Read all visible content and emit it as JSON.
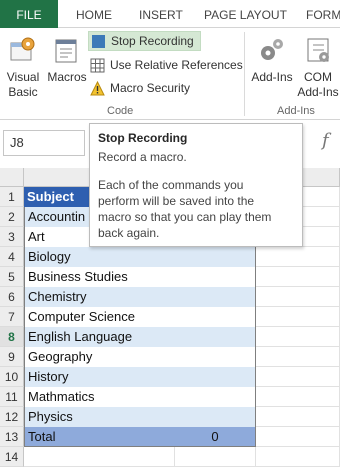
{
  "ribbon": {
    "tabs": [
      "FILE",
      "HOME",
      "INSERT",
      "PAGE LAYOUT",
      "FORM"
    ],
    "file_color": "#217346",
    "code_group": {
      "visual_basic": "Visual\nBasic",
      "macros": "Macros",
      "stop_recording": "Stop Recording",
      "relative_references": "Use Relative References",
      "macro_security": "Macro Security",
      "label": "Code"
    },
    "addins_group": {
      "addins": "Add-Ins",
      "com_addins": "COM\nAdd-Ins",
      "label": "Add-Ins"
    }
  },
  "formula_bar": {
    "name_box": "J8",
    "fx_icon": "fx-icon"
  },
  "tooltip": {
    "title": "Stop Recording",
    "subtitle": "Record a macro.",
    "body": "Each of the commands you\nperform will be saved into the\nmacro so that you can play them\nback again."
  },
  "sheet": {
    "row_numbers": [
      "1",
      "2",
      "3",
      "4",
      "5",
      "6",
      "7",
      "8",
      "9",
      "10",
      "11",
      "12",
      "13",
      "14"
    ],
    "selected_row": "8",
    "header": "Subject",
    "subjects": [
      "Accountin",
      "Art",
      "Biology",
      "Business Studies",
      "Chemistry",
      "Computer Science",
      "English Language",
      "Geography",
      "History",
      "Mathmatics",
      "Physics"
    ],
    "total_label": "Total",
    "total_value": "0",
    "colors": {
      "header_fill": "#2e5fb0",
      "band_fill": "#dce9f6",
      "total_fill": "#8eaadb"
    }
  }
}
